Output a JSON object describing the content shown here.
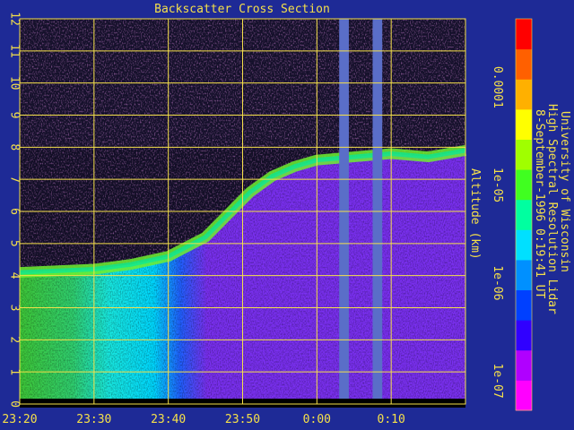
{
  "chart_data": {
    "type": "heatmap",
    "title": "Backscatter Cross Section",
    "ylabel": "Altitude (km)",
    "ylim": [
      0,
      12
    ],
    "y_ticks": [
      "0",
      "1",
      "2",
      "3",
      "4",
      "5",
      "6",
      "7",
      "8",
      "9",
      "10",
      "11",
      "12"
    ],
    "x_ticks": [
      "23:20",
      "23:30",
      "23:40",
      "23:50",
      "0:00",
      "0:10"
    ],
    "x_tick_minutes": [
      0,
      10,
      20,
      30,
      40,
      50
    ],
    "x_range_minutes": [
      0,
      60
    ],
    "grid": true,
    "colorbar": {
      "scale": "log",
      "range": [
        5e-08,
        0.0005
      ],
      "tick_labels": [
        "0.0001",
        "1e-05",
        "1e-06",
        "1e-07"
      ],
      "tick_values": [
        0.0001,
        1e-05,
        1e-06,
        1e-07
      ],
      "colors": [
        "#ff00ff",
        "#b000ff",
        "#3000ff",
        "#0040ff",
        "#0090ff",
        "#00e0ff",
        "#00ffa0",
        "#40ff20",
        "#a0ff00",
        "#ffff00",
        "#ffb000",
        "#ff6000",
        "#ff0000"
      ]
    },
    "data_gaps_minutes": [
      [
        43.0,
        44.3
      ],
      [
        47.5,
        48.8
      ]
    ],
    "features": [
      {
        "name": "",
        "boundary_time_minutes": [
          0,
          10,
          15,
          20,
          25,
          28,
          31,
          34,
          37,
          40,
          45,
          50,
          55,
          60
        ],
        "boundary_altitude_km": [
          4.1,
          4.2,
          4.35,
          4.6,
          5.2,
          5.9,
          6.6,
          7.1,
          7.4,
          7.6,
          7.7,
          7.8,
          7.7,
          7.9
        ]
      }
    ],
    "annotations": [
      "University of Wisconsin",
      "High Spectral Resolution Lidar",
      "8-September-1996  0:19:41 UT"
    ]
  }
}
